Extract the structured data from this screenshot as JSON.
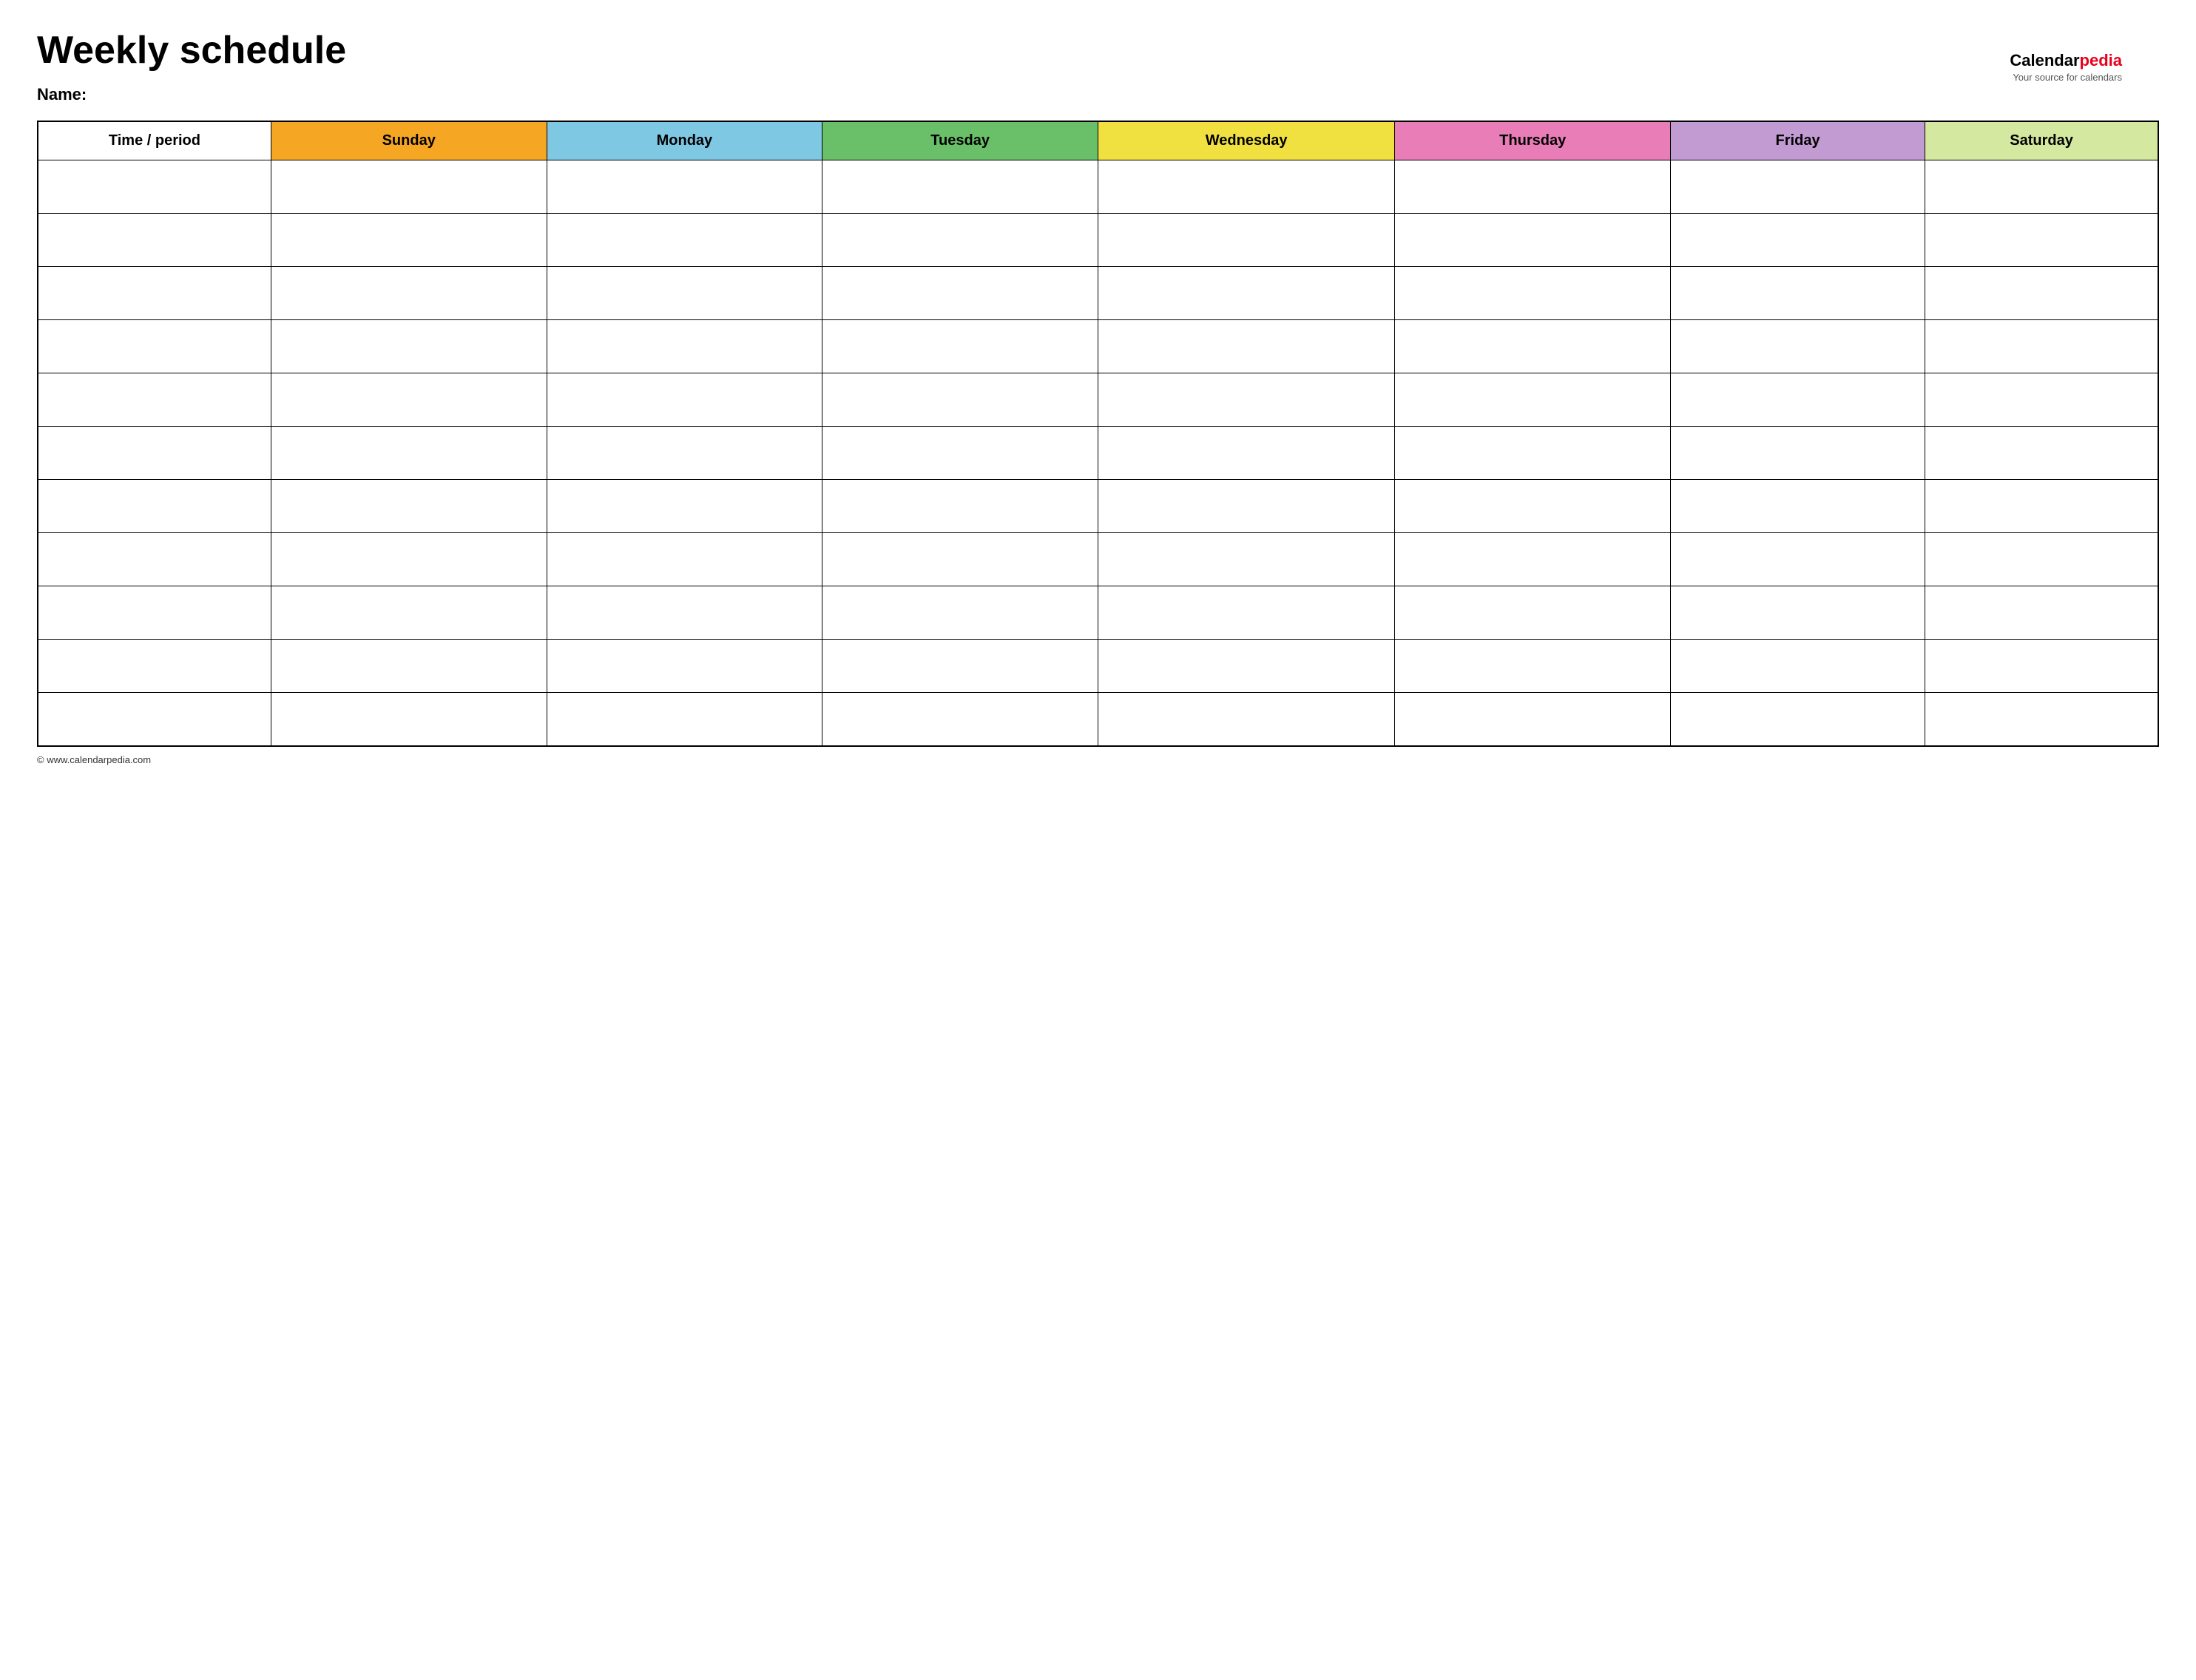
{
  "page": {
    "title": "Weekly schedule",
    "name_label": "Name:",
    "footer_url": "© www.calendarpedia.com"
  },
  "brand": {
    "calendar": "Calendar",
    "pedia": "pedia",
    "tagline": "Your source for calendars"
  },
  "table": {
    "headers": [
      {
        "id": "time",
        "label": "Time / period",
        "color": "#ffffff"
      },
      {
        "id": "sunday",
        "label": "Sunday",
        "color": "#f5a623"
      },
      {
        "id": "monday",
        "label": "Monday",
        "color": "#7ec8e3"
      },
      {
        "id": "tuesday",
        "label": "Tuesday",
        "color": "#6abf69"
      },
      {
        "id": "wednesday",
        "label": "Wednesday",
        "color": "#f0e040"
      },
      {
        "id": "thursday",
        "label": "Thursday",
        "color": "#e87db8"
      },
      {
        "id": "friday",
        "label": "Friday",
        "color": "#c39bd3"
      },
      {
        "id": "saturday",
        "label": "Saturday",
        "color": "#d4e8a0"
      }
    ],
    "row_count": 11
  }
}
